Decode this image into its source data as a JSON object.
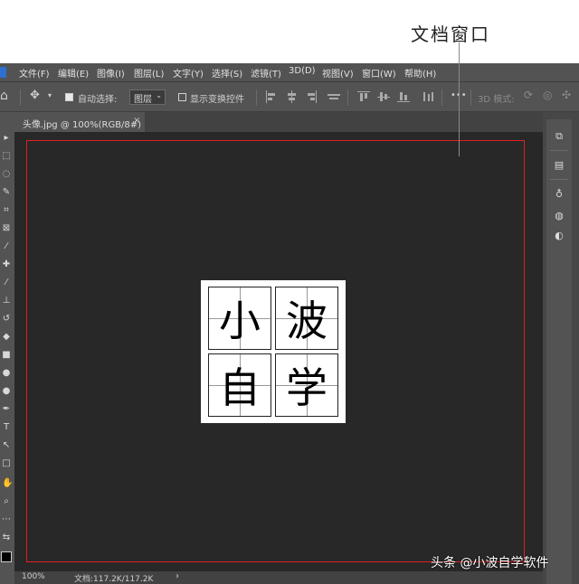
{
  "annotation": {
    "label": "文档窗口"
  },
  "menubar": {
    "items": [
      "文件(F)",
      "编辑(E)",
      "图像(I)",
      "图层(L)",
      "文字(Y)",
      "选择(S)",
      "滤镜(T)",
      "3D(D)",
      "视图(V)",
      "窗口(W)",
      "帮助(H)"
    ]
  },
  "options": {
    "auto_select_label": "自动选择:",
    "auto_select_checked": true,
    "auto_select_target": "图层",
    "show_transform_label": "显示变换控件",
    "show_transform_checked": false,
    "more": "•••",
    "mode_3d_label": "3D 模式:"
  },
  "document": {
    "tab_label": "头像.jpg @ 100%(RGB/8#)",
    "close_glyph": "×",
    "characters": [
      "小",
      "波",
      "自",
      "学"
    ]
  },
  "status": {
    "zoom": "100%",
    "doc_size": "文档:117.2K/117.2K",
    "arrow": "›"
  },
  "watermark": "头条 @小波自学软件",
  "colors": {
    "frame_highlight": "#e02020",
    "workspace": "#282828",
    "ui_gray": "#535353"
  }
}
